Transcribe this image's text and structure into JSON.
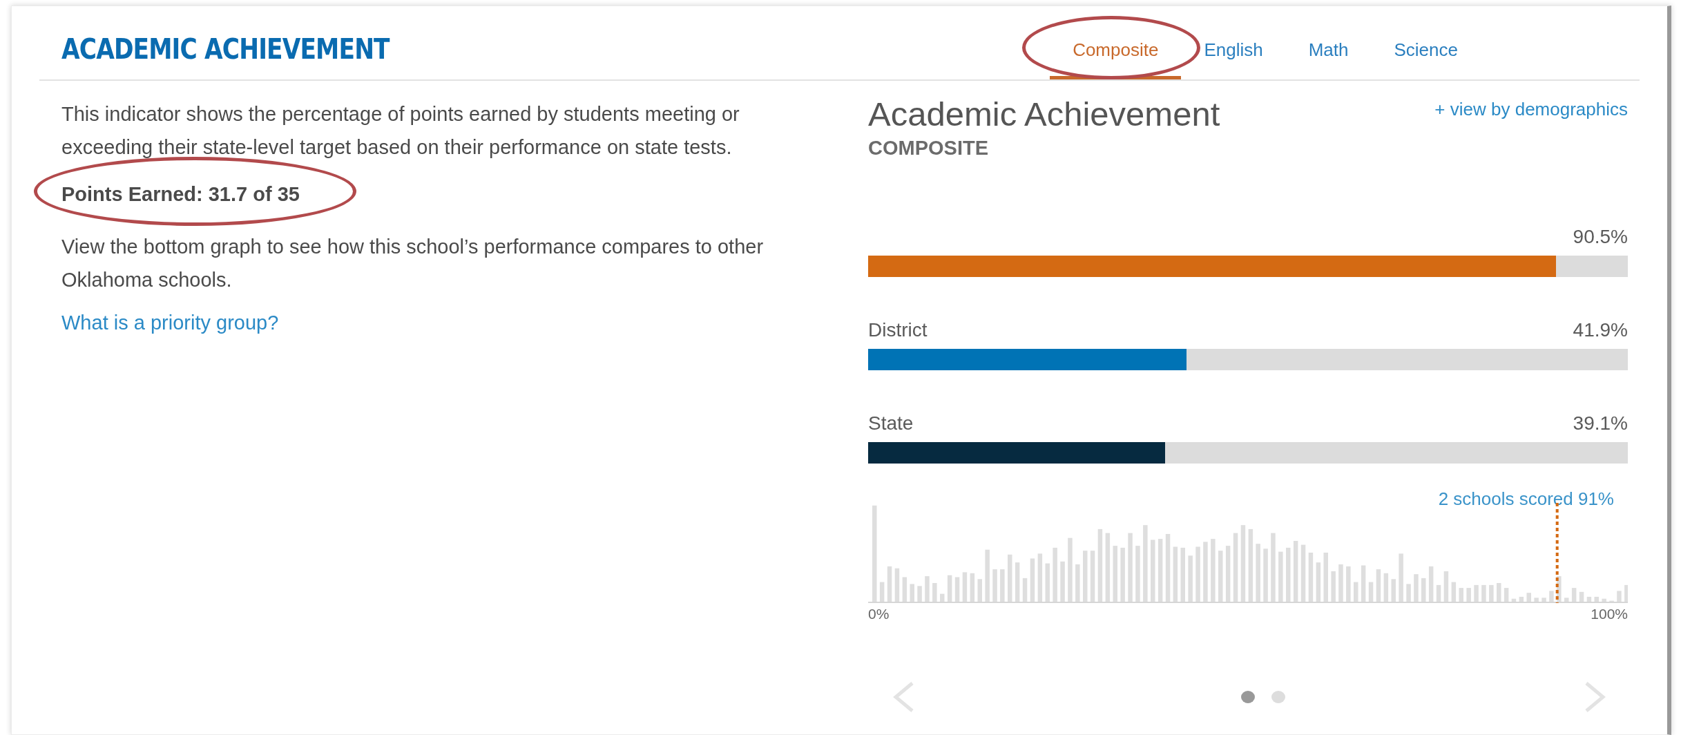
{
  "header": {
    "title": "ACADEMIC ACHIEVEMENT"
  },
  "tabs": [
    {
      "label": "Composite",
      "selected": true,
      "circled": true
    },
    {
      "label": "English",
      "selected": false,
      "circled": false
    },
    {
      "label": "Math",
      "selected": false,
      "circled": false
    },
    {
      "label": "Science",
      "selected": false,
      "circled": false
    }
  ],
  "description": "This indicator shows the percentage of points earned by students meeting or exceeding their state-level target based on their performance on state tests.",
  "points_earned": {
    "text": "Points Earned: 31.7 of 35",
    "circled": true
  },
  "note": "View the bottom graph to see how this school’s performance compares to other Oklahoma schools.",
  "help_link": "What is a priority group?",
  "panel": {
    "title": "Academic Achievement",
    "subtitle": "COMPOSITE",
    "demographics_link": "+ view by demographics"
  },
  "comparisons": [
    {
      "value": "90.5%",
      "level": 0.905,
      "color": "#d46a13"
    },
    {
      "label": "District",
      "value": "41.9%",
      "level": 0.419,
      "color": "#0073b5"
    },
    {
      "label": "State",
      "value": "39.1%",
      "level": 0.391,
      "color": "#062a40"
    }
  ],
  "distribution": {
    "annotation": "2 schools scored 91%",
    "axis_start": "0%",
    "axis_end": "100%"
  },
  "pager": {
    "pages": [
      {
        "selected": true
      },
      {
        "selected": false
      }
    ]
  }
}
